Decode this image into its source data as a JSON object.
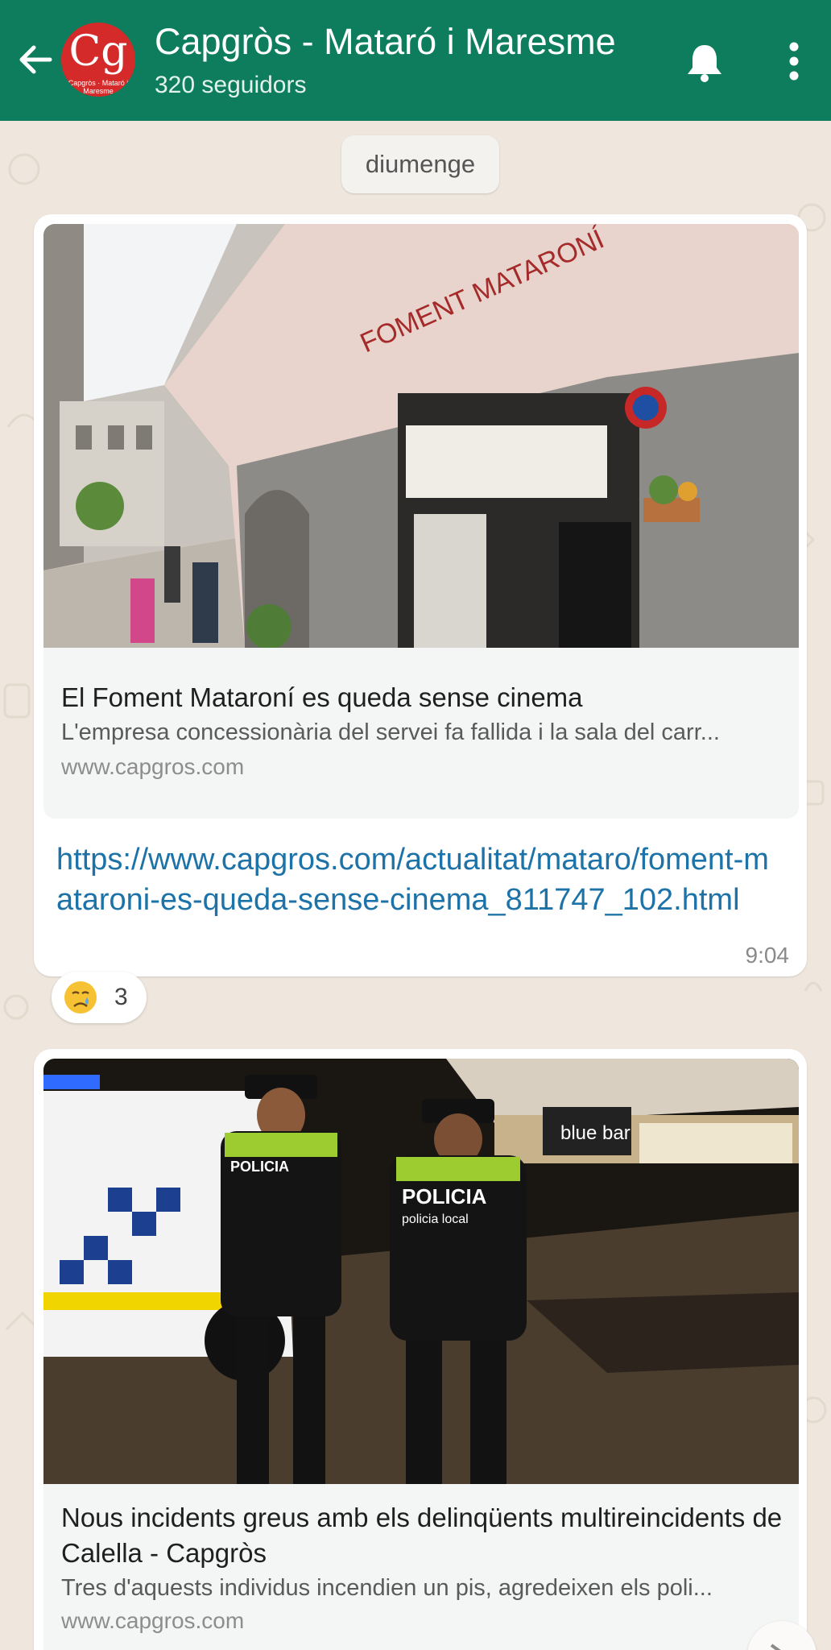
{
  "header": {
    "title": "Capgròs - Mataró i Maresme",
    "subtitle": "320 seguidors",
    "avatar_letters": "Cg",
    "avatar_caption": "Capgròs · Mataró i Maresme",
    "icons": [
      "arrow-left-icon",
      "bell-icon",
      "more-vert-icon"
    ]
  },
  "date_chip": "diumenge",
  "messages": [
    {
      "image_alt": "Foment Mataroní building entrance",
      "preview_title": "El Foment Mataroní es queda sense cinema",
      "preview_desc": "L'empresa concessionària del servei fa fallida i la sala del carr...",
      "preview_site": "www.capgros.com",
      "link": "https://www.capgros.com/actualitat/mataro/foment-mataroni-es-queda-sense-cinema_811747_102.html",
      "time": "9:04",
      "reaction": {
        "emoji": "crying-face",
        "count": "3"
      },
      "sign_text": "FOMENT MATARONÍ"
    },
    {
      "image_alt": "Two local police officers at night",
      "preview_title": "Nous incidents greus amb els delinqüents multireincidents de Calella - Capgròs",
      "preview_desc": "Tres d'aquests individus incendien un pis, agredeixen els poli...",
      "preview_site": "www.capgros.com",
      "sign_text": "blue bar",
      "vest_text": "POLICIA",
      "vest_sub": "policia local"
    }
  ],
  "colors": {
    "header": "#0d7d5e",
    "chat_bg": "#efe7dd",
    "link": "#1d73a8"
  }
}
